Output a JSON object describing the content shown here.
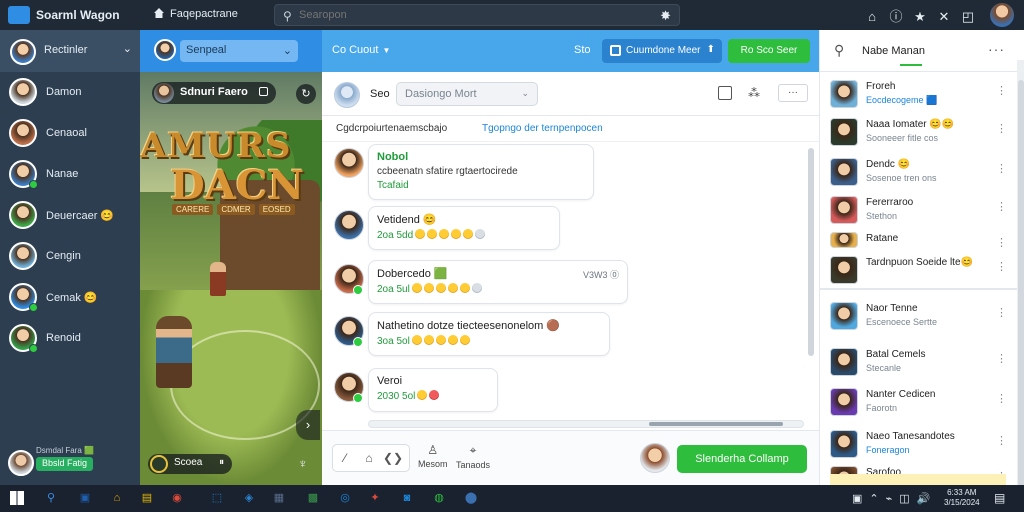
{
  "titlebar": {
    "app_title": "Soarml Wagon",
    "home_label": "Faqepactrane",
    "search_placeholder": "Searopon",
    "search_separator": "|",
    "icons": [
      "home-icon",
      "info-icon",
      "star-icon",
      "close-icon",
      "restore-icon"
    ],
    "icon_glyphs": [
      "⌂",
      "ⓘ",
      "★",
      "✕",
      "◰"
    ]
  },
  "left_sidebar": {
    "header_name": "Rectinler",
    "contacts": [
      {
        "name": "Damon",
        "color": "#cfd8df",
        "online": false
      },
      {
        "name": "Cenaoal",
        "color": "#c0704a",
        "online": false
      },
      {
        "name": "Nanae",
        "color": "#3a7cc4",
        "online": true
      },
      {
        "name": "Deuercaer 😊",
        "color": "#3eaa4a",
        "online": false
      },
      {
        "name": "Cengin",
        "color": "#6fb0d9",
        "online": false
      },
      {
        "name": "Cemak 😊",
        "color": "#2f8de4",
        "online": true
      },
      {
        "name": "Renoid",
        "color": "#33a04a",
        "online": true
      }
    ],
    "footer_text": "Dsmdal Fara 🟩",
    "footer_badge": "Bbsld Fatig"
  },
  "game_panel": {
    "header_label": "Senpeal",
    "title_label": "Sdnuri Faero",
    "title_count": "",
    "logo_line1": "AMURS",
    "logo_line2": "DACN",
    "logo_tags": [
      "CARERE",
      "CDMER",
      "EOSED"
    ],
    "bottom_label": "Scoea",
    "bottom_pause": "⏸",
    "reload_glyph": "↻",
    "arrow_glyph": "›",
    "fav_glyph": "♆"
  },
  "chat_toolbar": {
    "call_label": "Co Cuout",
    "video_label": "Sto",
    "join_label": "Cuumdone Meer",
    "up_glyph": "⬆",
    "start_label": "Ro Sco Seer"
  },
  "conversation": {
    "name": "Seo",
    "select_value": "Dasiongo Mort",
    "icon_glyphs": [
      "",
      "⁂",
      "···"
    ],
    "banner_text": "Cgdcrpoiurtenaemscbajo",
    "banner_link": "Tgopngo der ternpenpocen"
  },
  "messages": [
    {
      "author": "Nobol",
      "author_green": true,
      "text": "ccbeenatn sfatire rgtaertocirede",
      "sub": "Tcafaid",
      "emoji": [],
      "meta": "",
      "color": "#f4a460"
    },
    {
      "author": "Vetidend 😊",
      "author_green": false,
      "text": "",
      "sub": "2oa 5dd",
      "emoji": [
        "y",
        "y",
        "y",
        "y",
        "y",
        "g"
      ],
      "meta": "",
      "color": "#3b6fa8"
    },
    {
      "author": "Dobercedo 🟩",
      "author_green": false,
      "text": "",
      "sub": "2oa 5ul",
      "emoji": [
        "y",
        "y",
        "y",
        "y",
        "y",
        "g"
      ],
      "meta": "V3W3 ⓪",
      "color": "#c96b4a"
    },
    {
      "author": "Nathetino dotze tiecteesenonelom 🟤",
      "author_green": false,
      "text": "",
      "sub": "3oa 5ol",
      "emoji": [
        "y",
        "y",
        "y",
        "y",
        "y"
      ],
      "meta": "",
      "color": "#2e5a88"
    },
    {
      "author": "Veroi",
      "author_green": false,
      "text": "",
      "sub": "2030 5ol",
      "emoji": [
        "y",
        "r"
      ],
      "meta": "",
      "color": "#8a5a3a"
    }
  ],
  "composer": {
    "tool_glyphs": [
      "⁄",
      "⌂",
      "❮❯"
    ],
    "tab1_label": "Mesom",
    "tab1_glyph": "♙",
    "tab2_label": "Tanaods",
    "tab2_glyph": "⌖",
    "send_label": "Slenderha Collamp"
  },
  "right_sidebar": {
    "title": "Nabe Manan",
    "more_glyph": "···",
    "friends": [
      {
        "name": "Froreh",
        "status": "Eocdecogeme 🟦",
        "status_style": "blue",
        "color": "#6fb0d9"
      },
      {
        "name": "Naaa Iomater 😊😊",
        "status": "Sooneeer fitle cos",
        "status_style": "",
        "color": "#2b3a2b"
      },
      {
        "name": "Dendc 😊",
        "status": "Sosenoe tren ons",
        "status_style": "",
        "color": "#3b5f8a"
      },
      {
        "name": "Fererraroo",
        "status": "Stethon",
        "status_style": "",
        "color": "#d65a5a"
      },
      {
        "name": "Ratane",
        "status": "",
        "status_style": "",
        "color": "#e8b04a"
      },
      {
        "name": "Tardnpuon Soeide lte😊",
        "status": "",
        "status_style": "green",
        "color": "#3a3a2a"
      },
      {
        "name": "Naor Tenne",
        "status": "Escenoece Sertte",
        "status_style": "",
        "color": "#4fa8e0"
      },
      {
        "name": "Batal Cemels",
        "status": "Stecanle",
        "status_style": "",
        "color": "#2a4a6a"
      },
      {
        "name": "Nanter Cedicen",
        "status": "Faorotn",
        "status_style": "",
        "color": "#6a3ab0"
      },
      {
        "name": "Naeo Tanesandotes",
        "status": "Foneragon",
        "status_style": "blue",
        "color": "#2e5a88"
      },
      {
        "name": "Sarofoo",
        "status": "",
        "status_style": "",
        "color": "#7a4a2a"
      }
    ]
  },
  "taskbar": {
    "apps": [
      {
        "glyph": "⚲",
        "color": "#3a8ee6"
      },
      {
        "glyph": "▣",
        "color": "#1e5fb0"
      },
      {
        "glyph": "⌂",
        "color": "#e6a800"
      },
      {
        "glyph": "▤",
        "color": "#e6b800"
      },
      {
        "glyph": "◉",
        "color": "#e04a3a"
      },
      {
        "glyph": "⬚",
        "color": "#1c86d8"
      },
      {
        "glyph": "◈",
        "color": "#2b82cf"
      },
      {
        "glyph": "▦",
        "color": "#5a6c8a"
      },
      {
        "glyph": "▩",
        "color": "#3a9a4a"
      },
      {
        "glyph": "◎",
        "color": "#1c86d8"
      },
      {
        "glyph": "✦",
        "color": "#e04a3a"
      },
      {
        "glyph": "◙",
        "color": "#1c86d8"
      },
      {
        "glyph": "◍",
        "color": "#2ebd3c"
      },
      {
        "glyph": "⬤",
        "color": "#3a6fb0"
      }
    ],
    "tray_glyphs": [
      "▣",
      "⌃",
      "⌁",
      "◫",
      "🔊"
    ],
    "clock_line1": "6:33 AM",
    "clock_line2": "3/15/2024",
    "notif_glyph": "▤"
  }
}
